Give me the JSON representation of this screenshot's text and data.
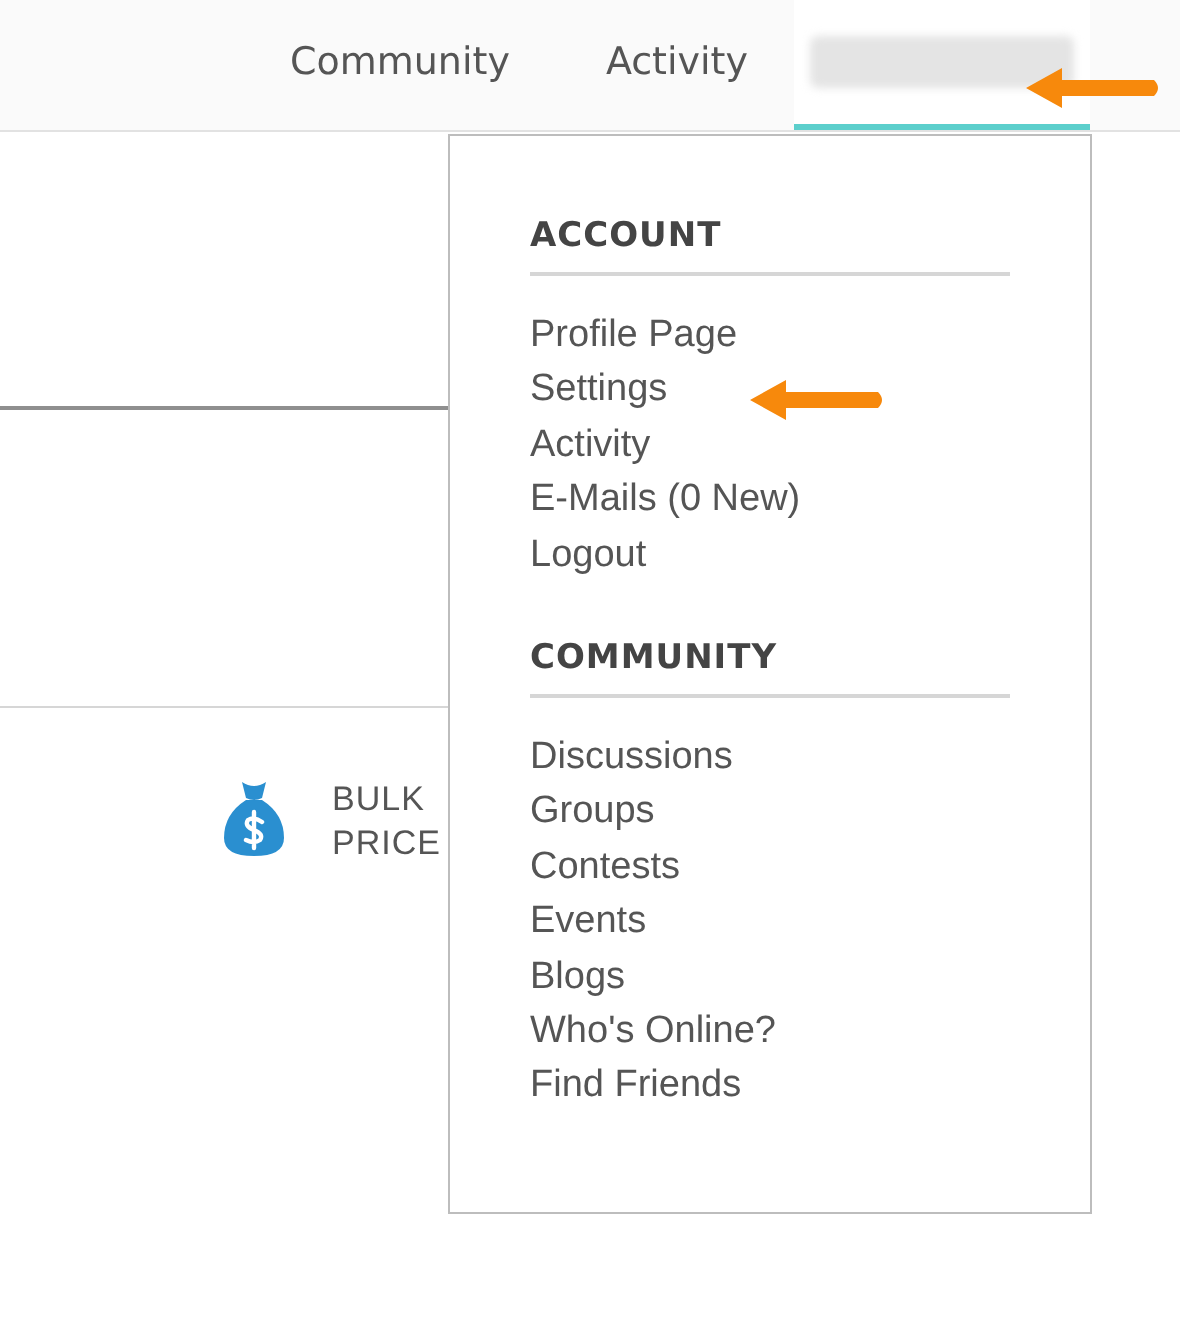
{
  "nav": {
    "items": [
      {
        "label": "Community",
        "selected": false
      },
      {
        "label": "Activity",
        "selected": false
      }
    ],
    "user_menu": {
      "selected": true
    }
  },
  "promo": {
    "lines": [
      "BULK",
      "PRICE"
    ]
  },
  "dropdown": {
    "sections": [
      {
        "heading": "ACCOUNT",
        "items": [
          "Profile Page",
          "Settings",
          "Activity",
          "E-Mails (0 New)",
          "Logout"
        ]
      },
      {
        "heading": "COMMUNITY",
        "items": [
          "Discussions",
          "Groups",
          "Contests",
          "Events",
          "Blogs",
          "Who's Online?",
          "Find Friends"
        ]
      }
    ]
  },
  "annotations": [
    {
      "kind": "arrow"
    },
    {
      "kind": "arrow"
    }
  ]
}
